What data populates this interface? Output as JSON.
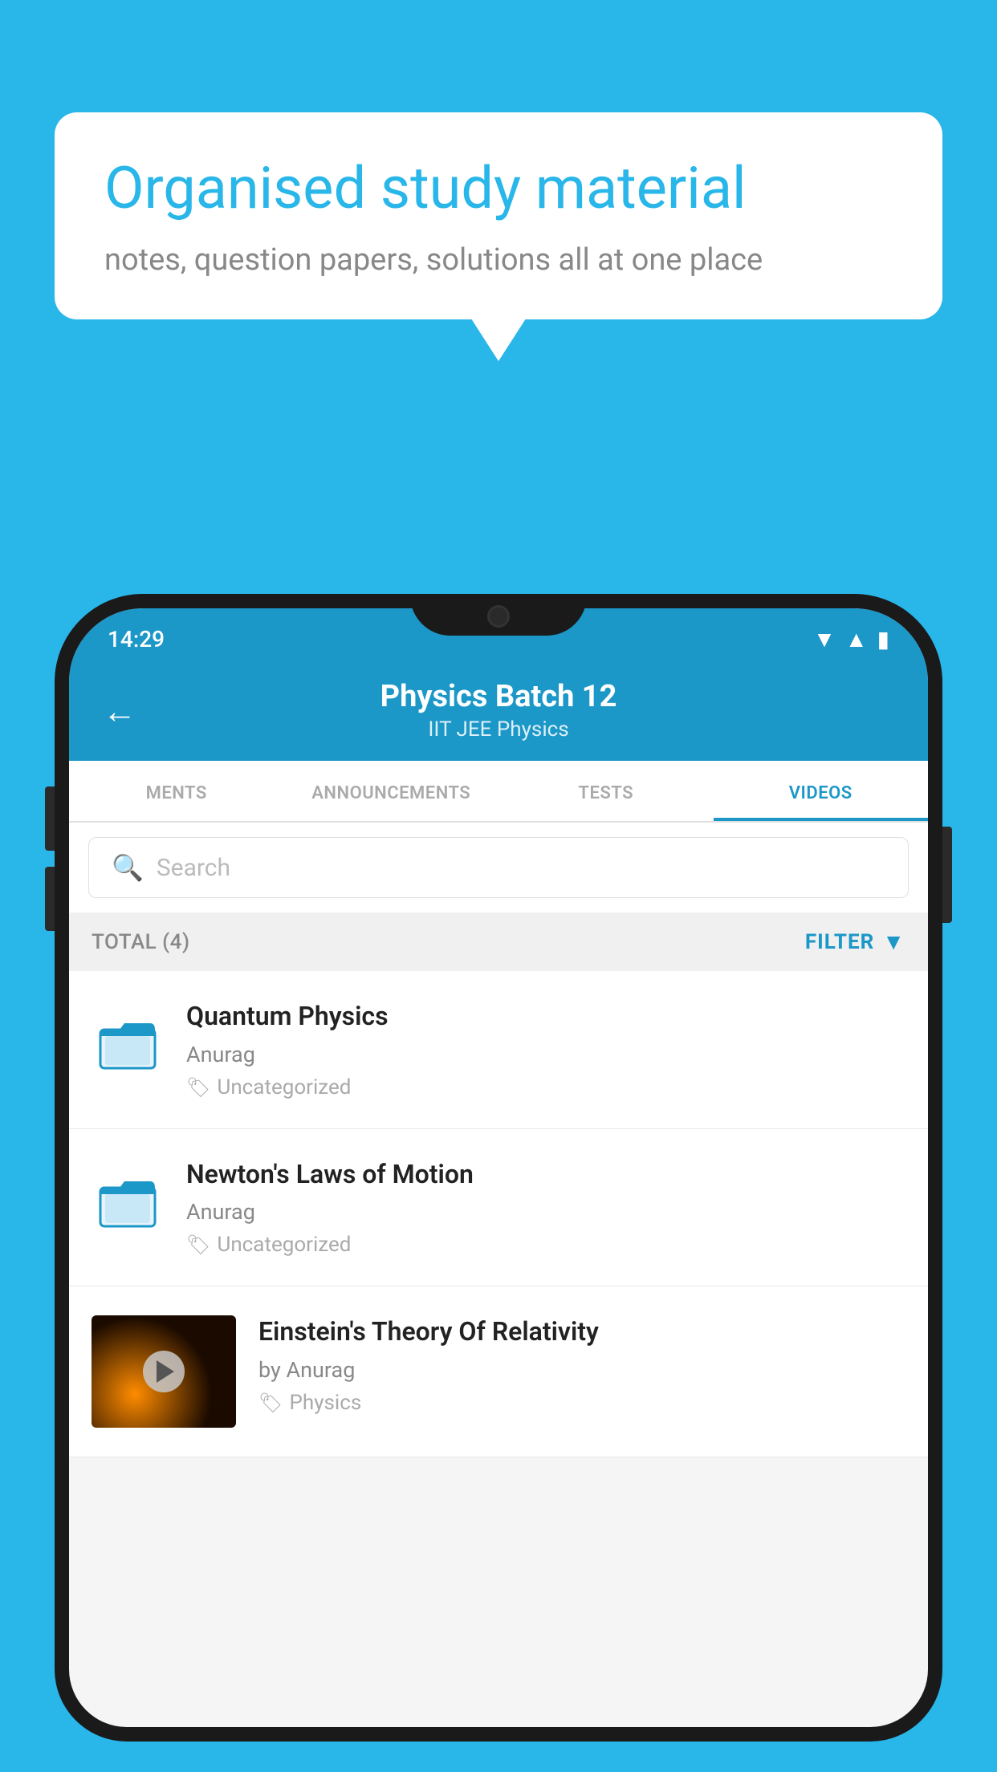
{
  "bubble": {
    "title": "Organised study material",
    "subtitle": "notes, question papers, solutions all at one place"
  },
  "phone": {
    "statusBar": {
      "time": "14:29"
    },
    "header": {
      "title": "Physics Batch 12",
      "subtitle": "IIT JEE   Physics",
      "backLabel": "←"
    },
    "tabs": [
      {
        "label": "MENTS",
        "active": false
      },
      {
        "label": "ANNOUNCEMENTS",
        "active": false
      },
      {
        "label": "TESTS",
        "active": false
      },
      {
        "label": "VIDEOS",
        "active": true
      }
    ],
    "search": {
      "placeholder": "Search"
    },
    "filterBar": {
      "total": "TOTAL (4)",
      "filterLabel": "FILTER"
    },
    "videos": [
      {
        "title": "Quantum Physics",
        "author": "Anurag",
        "tag": "Uncategorized",
        "type": "folder"
      },
      {
        "title": "Newton's Laws of Motion",
        "author": "Anurag",
        "tag": "Uncategorized",
        "type": "folder"
      },
      {
        "title": "Einstein's Theory Of Relativity",
        "author": "by Anurag",
        "tag": "Physics",
        "type": "video"
      }
    ]
  }
}
